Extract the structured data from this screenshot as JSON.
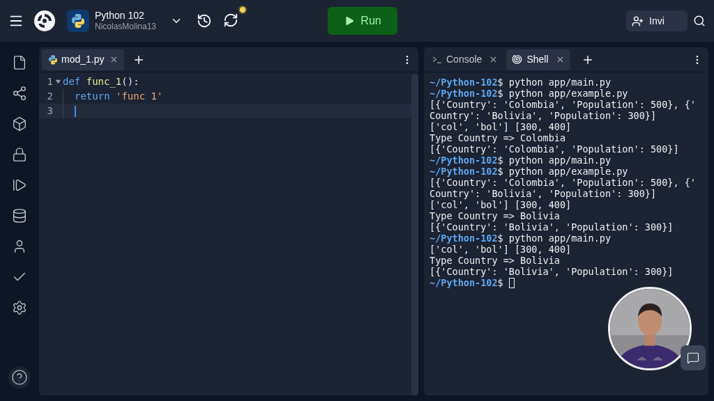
{
  "header": {
    "project_title": "Python 102",
    "project_owner": "NicolasMolina13",
    "run_button": "Run",
    "invite_button": "Invi",
    "sync_pending": true
  },
  "sidebar": {
    "items": [
      {
        "kind": "files"
      },
      {
        "kind": "git"
      },
      {
        "kind": "packages"
      },
      {
        "kind": "secrets"
      },
      {
        "kind": "debugger"
      },
      {
        "kind": "database"
      },
      {
        "kind": "auth"
      },
      {
        "kind": "tests"
      },
      {
        "kind": "settings"
      }
    ]
  },
  "editor": {
    "tabs": [
      {
        "label": "mod_1.py",
        "selected": true
      }
    ],
    "lines": [
      {
        "number": "1",
        "foldable": true,
        "active": false,
        "tokens": [
          {
            "kind": "keyword",
            "text": "def"
          },
          {
            "kind": "function",
            "text": " func_1"
          },
          {
            "kind": "plain",
            "text": "():"
          }
        ]
      },
      {
        "number": "2",
        "foldable": false,
        "active": false,
        "indented": true,
        "tokens": [
          {
            "kind": "keyword",
            "text": "return"
          },
          {
            "kind": "string",
            "text": " 'func 1'"
          }
        ]
      },
      {
        "number": "3",
        "foldable": false,
        "active": true,
        "indented": true
      }
    ]
  },
  "terminal": {
    "tabs": [
      {
        "label": "Console",
        "kind": "console",
        "selected": false
      },
      {
        "label": "Shell",
        "kind": "shell",
        "selected": true
      }
    ],
    "lines": [
      {
        "kind": "command",
        "prompt": "~/Python-102",
        "text": "$ python app/main.py"
      },
      {
        "kind": "command",
        "prompt": "~/Python-102",
        "text": "$ python app/example.py"
      },
      {
        "kind": "output",
        "text": "[{'Country': 'Colombia', 'Population': 500}, {'"
      },
      {
        "kind": "output",
        "text": "Country': 'Bolivia', 'Population': 300}]"
      },
      {
        "kind": "output",
        "text": "['col', 'bol'] [300, 400]"
      },
      {
        "kind": "output",
        "text": "Type Country => Colombia"
      },
      {
        "kind": "output",
        "text": "[{'Country': 'Colombia', 'Population': 500}]"
      },
      {
        "kind": "command",
        "prompt": "~/Python-102",
        "text": "$ python app/main.py"
      },
      {
        "kind": "command",
        "prompt": "~/Python-102",
        "text": "$ python app/example.py"
      },
      {
        "kind": "output",
        "text": "[{'Country': 'Colombia', 'Population': 500}, {'"
      },
      {
        "kind": "output",
        "text": "Country': 'Bolivia', 'Population': 300}]"
      },
      {
        "kind": "output",
        "text": "['col', 'bol'] [300, 400]"
      },
      {
        "kind": "output",
        "text": "Type Country => Bolivia"
      },
      {
        "kind": "output",
        "text": "[{'Country': 'Bolivia', 'Population': 300}]"
      },
      {
        "kind": "command",
        "prompt": "~/Python-102",
        "text": "$ python app/main.py"
      },
      {
        "kind": "output",
        "text": "['col', 'bol'] [300, 400]"
      },
      {
        "kind": "output",
        "text": "Type Country => Bolivia"
      },
      {
        "kind": "output",
        "text": "[{'Country': 'Bolivia', 'Population': 300}]"
      },
      {
        "kind": "input",
        "prompt": "~/Python-102",
        "text": "$"
      }
    ]
  }
}
